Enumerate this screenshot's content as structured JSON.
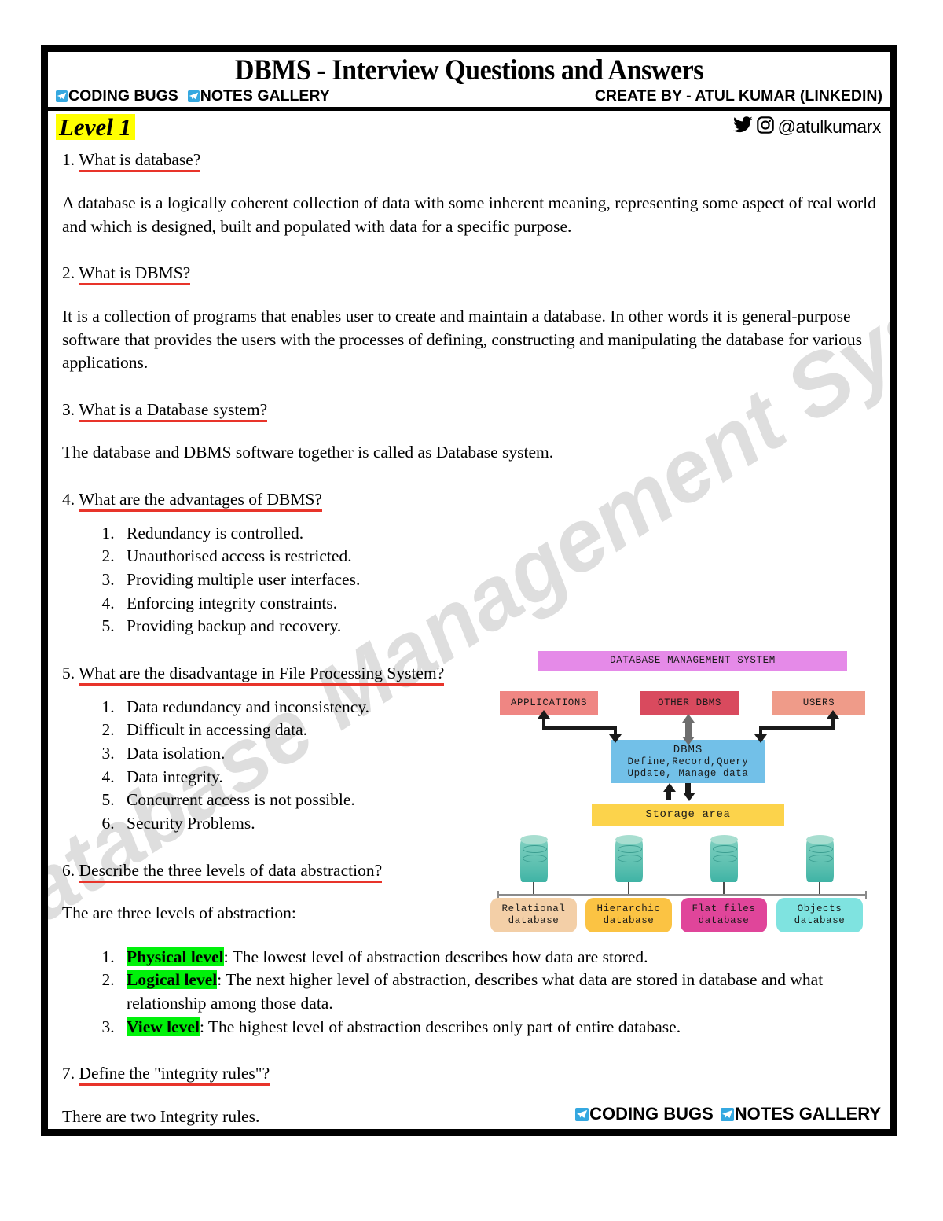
{
  "header": {
    "title": "DBMS - Interview Questions and Answers",
    "brand_1": "CODING BUGS",
    "brand_2": "NOTES GALLERY",
    "credit": "CREATE BY - ATUL KUMAR (LINKEDIN)",
    "level_tag": "Level 1",
    "social_handle": "@atulkumarx"
  },
  "watermark": "Database Management System",
  "content": {
    "q1": {
      "num": "1.",
      "text": "What is database?"
    },
    "a1": "A database is a logically coherent collection of data with some inherent meaning, representing some aspect of real world and which is designed, built and populated with data for a specific purpose.",
    "q2": {
      "num": "2.",
      "text": "What is DBMS?"
    },
    "a2": "It is a collection of programs that enables user to create and maintain a database. In other words it is general-purpose software that provides the users with the processes of defining, constructing and manipulating the database for various applications.",
    "q3": {
      "num": "3.",
      "text": "What is a Database system?"
    },
    "a3": "The database and DBMS software together is called as Database system.",
    "q4": {
      "num": "4.",
      "text": "What are the advantages of DBMS?"
    },
    "a4_list": [
      "Redundancy is controlled.",
      "Unauthorised access is restricted.",
      "Providing multiple user interfaces.",
      "Enforcing integrity constraints.",
      "Providing backup and recovery."
    ],
    "q5": {
      "num": "5.",
      "text": "What are the disadvantage in File Processing System?"
    },
    "a5_list": [
      "Data redundancy and inconsistency.",
      "Difficult in accessing data.",
      "Data isolation.",
      "Data integrity.",
      "Concurrent access is not possible.",
      "Security Problems."
    ],
    "q6": {
      "num": "6.",
      "text": "Describe the three levels of data abstraction?"
    },
    "a6_intro": "The are three levels of abstraction:",
    "a6_list": [
      {
        "term": "Physical level",
        "rest": ": The lowest level of abstraction describes how data are stored."
      },
      {
        "term": "Logical level",
        "rest": ": The next higher level of abstraction, describes what data are stored in database and what relationship among those data."
      },
      {
        "term": "View level",
        "rest": ": The highest level of abstraction describes only part of entire database."
      }
    ],
    "q7": {
      "num": "7.",
      "text": "Define the \"integrity rules\"?"
    },
    "a7": "There are two Integrity rules."
  },
  "diagram": {
    "title": "DATABASE MANAGEMENT SYSTEM",
    "applications": "APPLICATIONS",
    "other_dbms": "OTHER DBMS",
    "users": "USERS",
    "dbms_line1": "DBMS",
    "dbms_line2": "Define,Record,Query",
    "dbms_line3": "Update, Manage data",
    "storage": "Storage area",
    "db_types": [
      {
        "line1": "Relational",
        "line2": "database"
      },
      {
        "line1": "Hierarchic",
        "line2": "database"
      },
      {
        "line1": "Flat files",
        "line2": "database"
      },
      {
        "line1": "Objects",
        "line2": "database"
      }
    ]
  },
  "footer": {
    "brand_1": "CODING BUGS",
    "brand_2": "NOTES GALLERY"
  },
  "colors": {
    "highlight_yellow": "#ffff00",
    "highlight_green": "#00f10a",
    "question_underline": "#e8342a",
    "telegram_blue": "#35a8e0",
    "diagram_title": "#e58ae8",
    "diagram_apps": "#ef8683",
    "diagram_other": "#d94a5e",
    "diagram_users": "#ef9b89",
    "diagram_dbms": "#72c0e8",
    "diagram_storage": "#fcd34b"
  }
}
